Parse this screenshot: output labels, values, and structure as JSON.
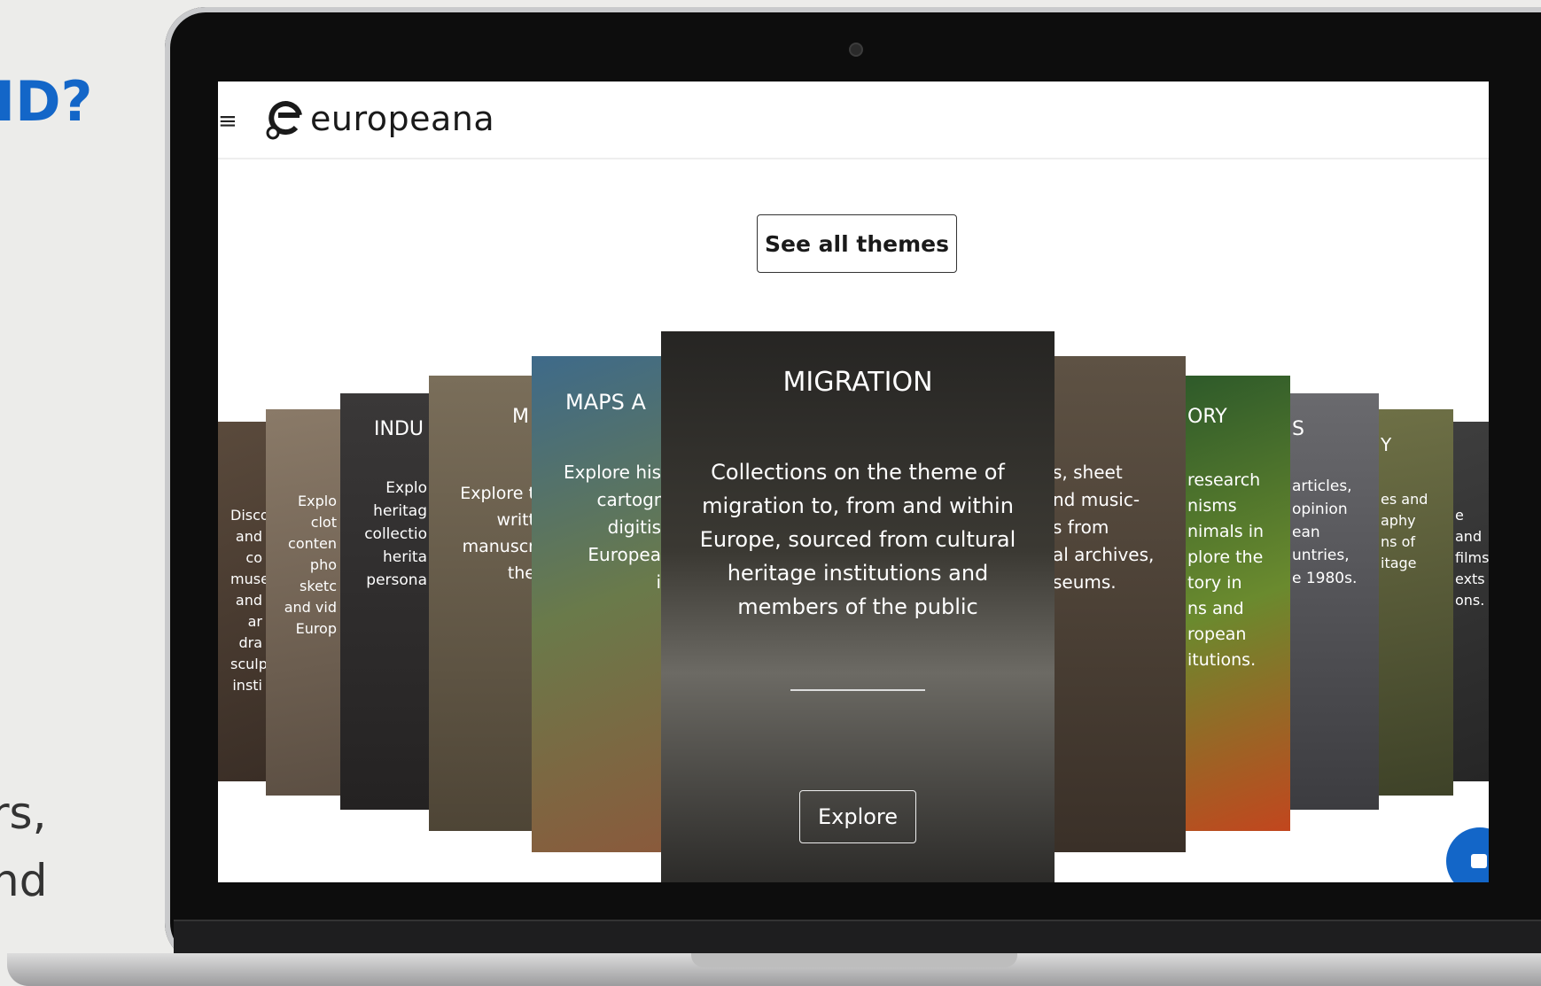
{
  "background": {
    "heading_fragment": "ID?",
    "body_fragments": [
      "rs,",
      "nd"
    ],
    "accent_color": "#1366c8"
  },
  "site": {
    "logo_text": "europeana",
    "menu_icon": "hamburger-icon"
  },
  "actions": {
    "see_all": "See all themes",
    "explore": "Explore"
  },
  "carousel": {
    "featured": {
      "title": "MIGRATION",
      "description": "Collections on the theme of migration to, from and within Europe, sourced from cultural heritage institutions and members of the public"
    },
    "left_cards": [
      {
        "lines": [
          "Disco",
          "and",
          "co",
          "muse",
          "and ar",
          "dra",
          "sculptu",
          "insti"
        ]
      },
      {
        "lines": [
          "Explo",
          "clot",
          "conten",
          "pho",
          "sketc",
          "and vid",
          "Europ"
        ]
      },
      {
        "title": "INDU",
        "lines": [
          "Explo",
          "heritag",
          "collectio",
          "herita",
          "persona"
        ]
      },
      {
        "title": "M",
        "lines": [
          "Explore t",
          "writt",
          "manuscr",
          "the"
        ]
      },
      {
        "title": "MAPS A",
        "lines": [
          "Explore his",
          "cartogr",
          "digitis",
          "Europea",
          "i"
        ]
      }
    ],
    "right_cards": [
      {
        "lines": [
          "s, sheet",
          "nd music-",
          "s from",
          "al archives,",
          "seums."
        ]
      },
      {
        "title": "ORY",
        "lines": [
          "research",
          "nisms",
          "nimals in",
          "plore the",
          "tory in",
          "ns and",
          "ropean",
          "itutions."
        ]
      },
      {
        "title": "S",
        "lines": [
          "articles,",
          "opinion",
          "ean",
          "untries,",
          "e 1980s."
        ]
      },
      {
        "title": "Y",
        "lines": [
          "es and",
          "aphy",
          "ns of",
          "itage"
        ]
      },
      {
        "lines": [
          "e and",
          "films,",
          "exts",
          "ons."
        ]
      }
    ]
  },
  "chat": {
    "icon": "chat-icon"
  }
}
